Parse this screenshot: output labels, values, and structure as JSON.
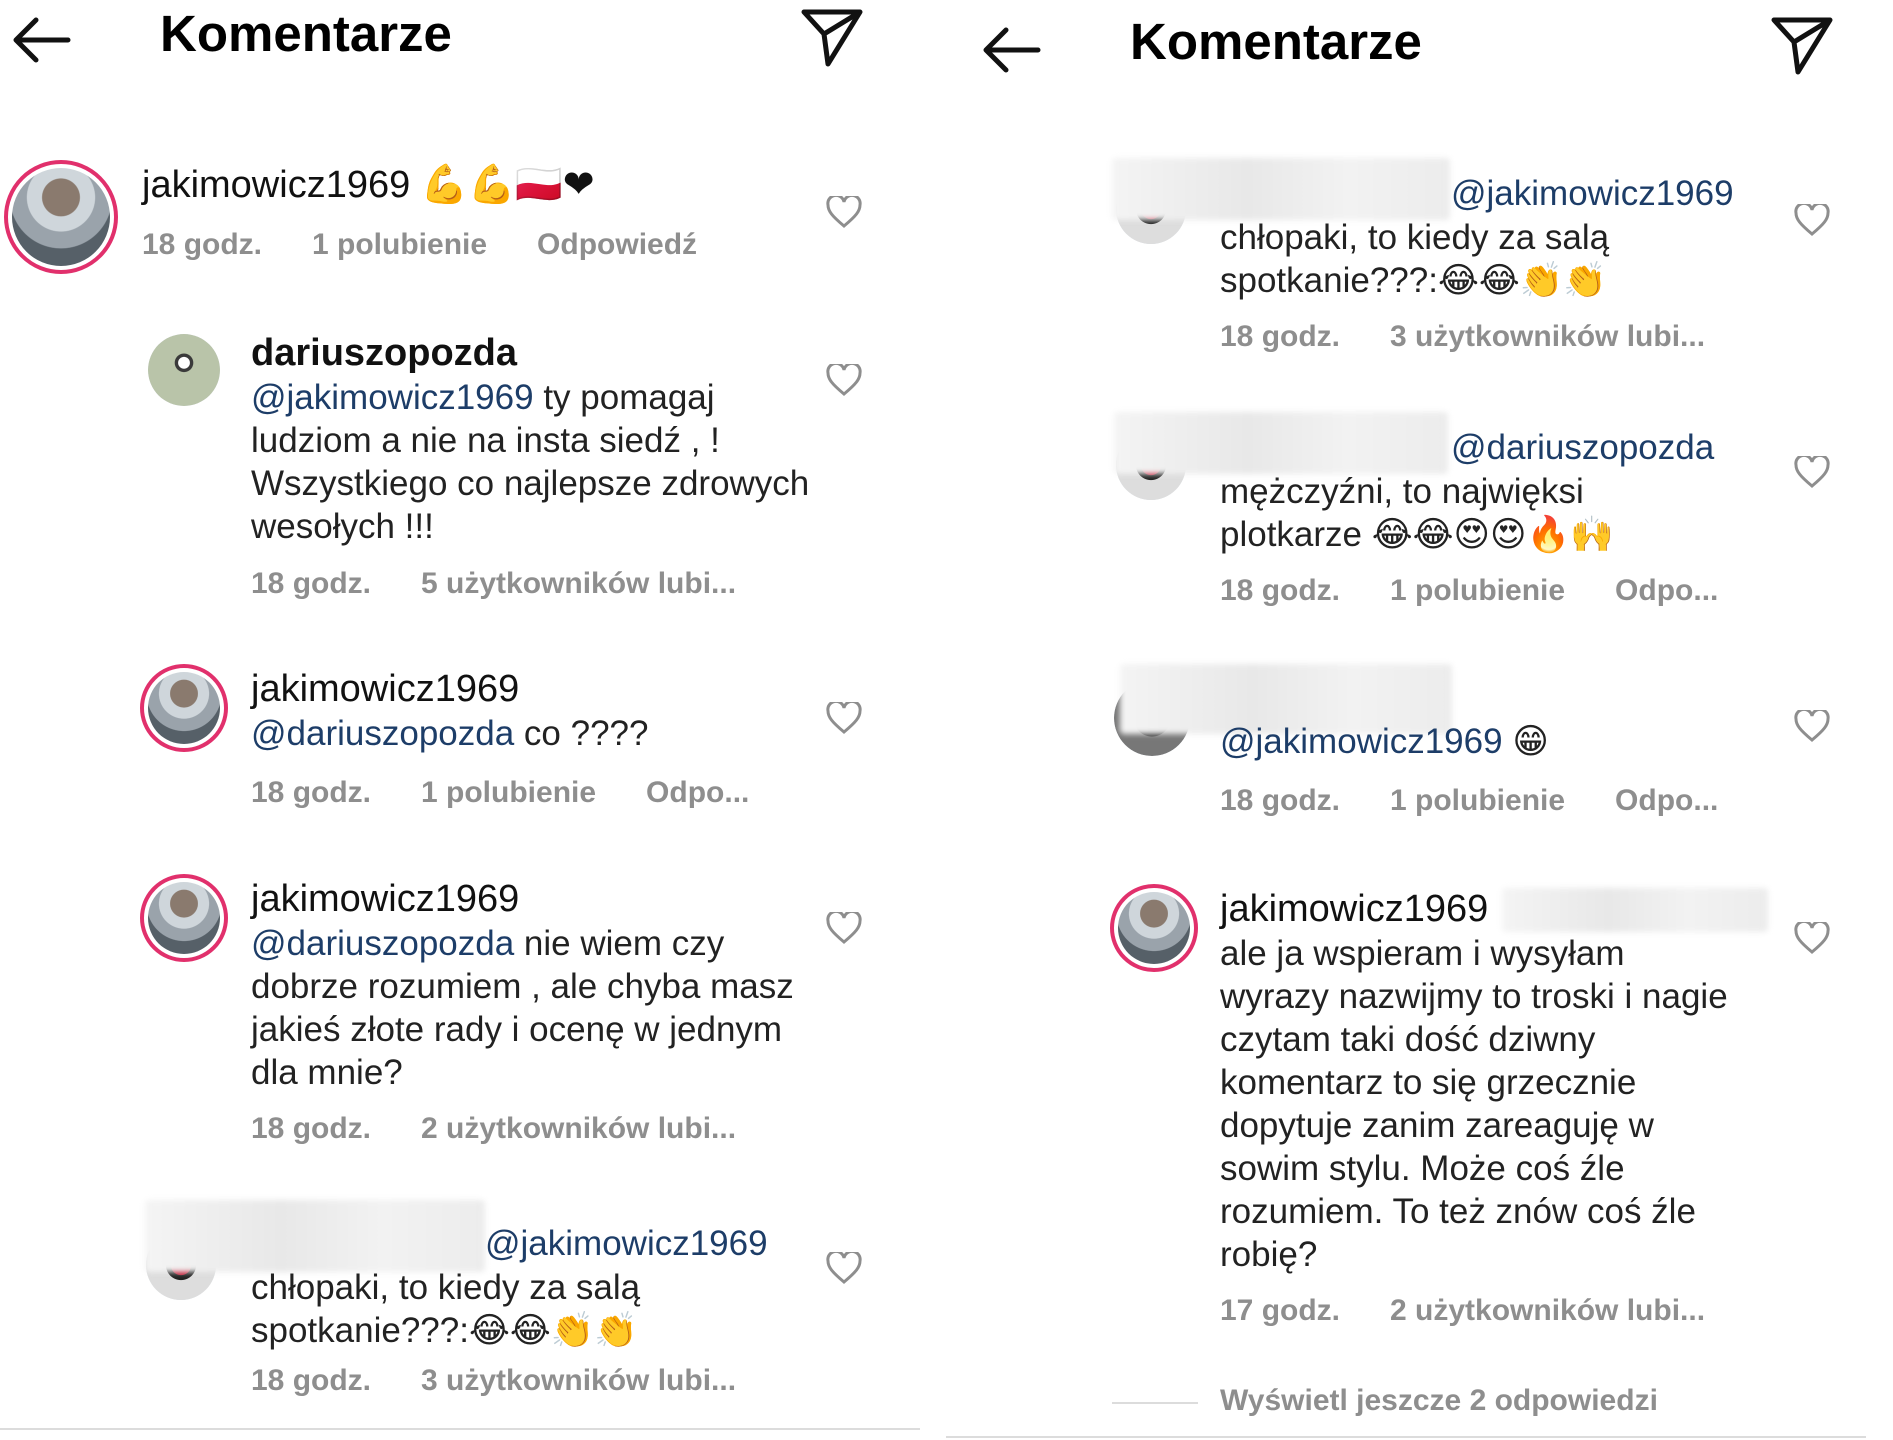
{
  "left": {
    "title": "Komentarze",
    "comments": [
      {
        "user": "jakimowicz1969",
        "emoji": "💪💪🇵🇱❤",
        "time": "18 godz.",
        "likes": "1 polubienie",
        "reply": "Odpowiedź"
      },
      {
        "user": "dariuszopozda",
        "mention": "@jakimowicz1969",
        "text": " ty pomagaj ludziom a nie na insta siedź , ! Wszystkiego co najlepsze zdrowych wesołych !!!",
        "time": "18 godz.",
        "likes": "5 użytkowników lubi..."
      },
      {
        "user": "jakimowicz1969",
        "mention": "@dariuszopozda",
        "text": " co ????",
        "time": "18 godz.",
        "likes": "1 polubienie",
        "reply": "Odpo..."
      },
      {
        "user": "jakimowicz1969",
        "mention": "@dariuszopozda",
        "text": " nie wiem czy dobrze rozumiem , ale chyba masz jakieś złote rady i ocenę w jednym dla mnie?",
        "time": "18 godz.",
        "likes": "2 użytkowników lubi..."
      },
      {
        "mention": "@jakimowicz1969",
        "text": "chłopaki, to kiedy za salą spotkanie???:",
        "emoji": "😂😂👏👏",
        "time": "18 godz.",
        "likes": "3 użytkowników lubi..."
      }
    ]
  },
  "right": {
    "title": "Komentarze",
    "comments": [
      {
        "mention": "@jakimowicz1969",
        "text": "chłopaki, to kiedy za salą spotkanie???:",
        "emoji": "😂😂👏👏",
        "time": "18 godz.",
        "likes": "3 użytkowników lubi..."
      },
      {
        "mention": "@dariuszopozda",
        "text": "mężczyźni, to najwięksi plotkarze ",
        "emoji": "😂😂😍😍🔥🙌",
        "time": "18 godz.",
        "likes": "1 polubienie",
        "reply": "Odpo..."
      },
      {
        "mention": "@jakimowicz1969",
        "emoji": "😁",
        "time": "18 godz.",
        "likes": "1 polubienie",
        "reply": "Odpo..."
      },
      {
        "user": "jakimowicz1969",
        "text": "ale ja wspieram i wysyłam wyrazy nazwijmy to troski i nagie czytam taki dość dziwny komentarz to się grzecznie dopytuje zanim zareaguję w sowim stylu. Może coś źle rozumiem. To też znów coś źle robię?",
        "time": "17 godz.",
        "likes": "2 użytkowników lubi..."
      }
    ],
    "view_more": "Wyświetl jeszcze 2 odpowiedzi"
  }
}
